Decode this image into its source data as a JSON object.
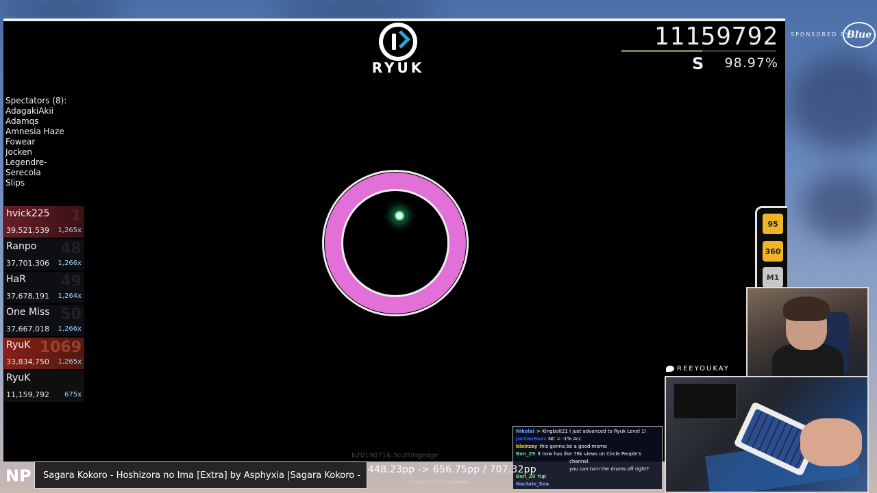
{
  "header": {
    "brand": "RYUK"
  },
  "hud": {
    "score": "11159792",
    "rank": "S",
    "accuracy": "98.97%",
    "score_progress": 0.52
  },
  "spectators": {
    "title": "Spectators (8):",
    "names": [
      "AdagakiAkii",
      "Adamqs",
      "Amnesia Haze",
      "Fowear",
      "Jocken",
      "Legendre-",
      "Serecola",
      "Slips"
    ]
  },
  "leaderboard": [
    {
      "name": "hvick225",
      "score": "39,521,539",
      "combo": "1,265x",
      "rank": "1",
      "style": "top"
    },
    {
      "name": "Ranpo",
      "score": "37,701,306",
      "combo": "1,266x",
      "rank": "48",
      "style": ""
    },
    {
      "name": "HaR",
      "score": "37,678,191",
      "combo": "1,264x",
      "rank": "49",
      "style": ""
    },
    {
      "name": "One Miss",
      "score": "37,667,018",
      "combo": "1,266x",
      "rank": "50",
      "style": ""
    },
    {
      "name": "RyuK",
      "score": "33,834,750",
      "combo": "1,265x",
      "rank": "1069",
      "style": "me"
    },
    {
      "name": "RyuK",
      "score": "11,159,792",
      "combo": "675x",
      "rank": "",
      "style": "cur"
    }
  ],
  "keys": {
    "k1": "95",
    "k2": "360",
    "m1": "M1"
  },
  "version": "b20190716.3cuttingedge",
  "sponsor": {
    "text": "SPONSORED BY",
    "logo": "Blue"
  },
  "twitter": {
    "handle": "REEYOUKAY"
  },
  "chat": [
    {
      "user": "Nikolai",
      "color": "#6aa4ff",
      "text": "> Kingbolt21 I just advanced to Ryuk Level 1!"
    },
    {
      "user": "JordanBuzz",
      "color": "#2a5cff",
      "text": "NC = -1% Acc"
    },
    {
      "user": "blairzey",
      "color": "#e3d24a",
      "text": "this gonna be a good meme"
    },
    {
      "user": "Ben_Z9",
      "color": "#6fd36f",
      "text": "It now has like 76k views on Circle People's"
    },
    {
      "user": "",
      "color": "#fff",
      "text": "channel"
    },
    {
      "user": "",
      "color": "#fff",
      "text": "you can turn the drums off right?"
    },
    {
      "user": "Ben_Z9",
      "color": "#6fd36f",
      "text": "Yup"
    },
    {
      "user": "Noctale_Sea",
      "color": "#7aa7ff",
      "text": ""
    }
  ],
  "now_playing": {
    "label": "NP",
    "text": "Sagara Kokoro - Hoshizora no Ima [Extra] by Asphyxia  |Sagara Kokoro -"
  },
  "pp": {
    "text": "448.23pp -> 656.75pp / 707.32pp",
    "sub": "7.00x100 0.00x50 0.00xMiss"
  }
}
